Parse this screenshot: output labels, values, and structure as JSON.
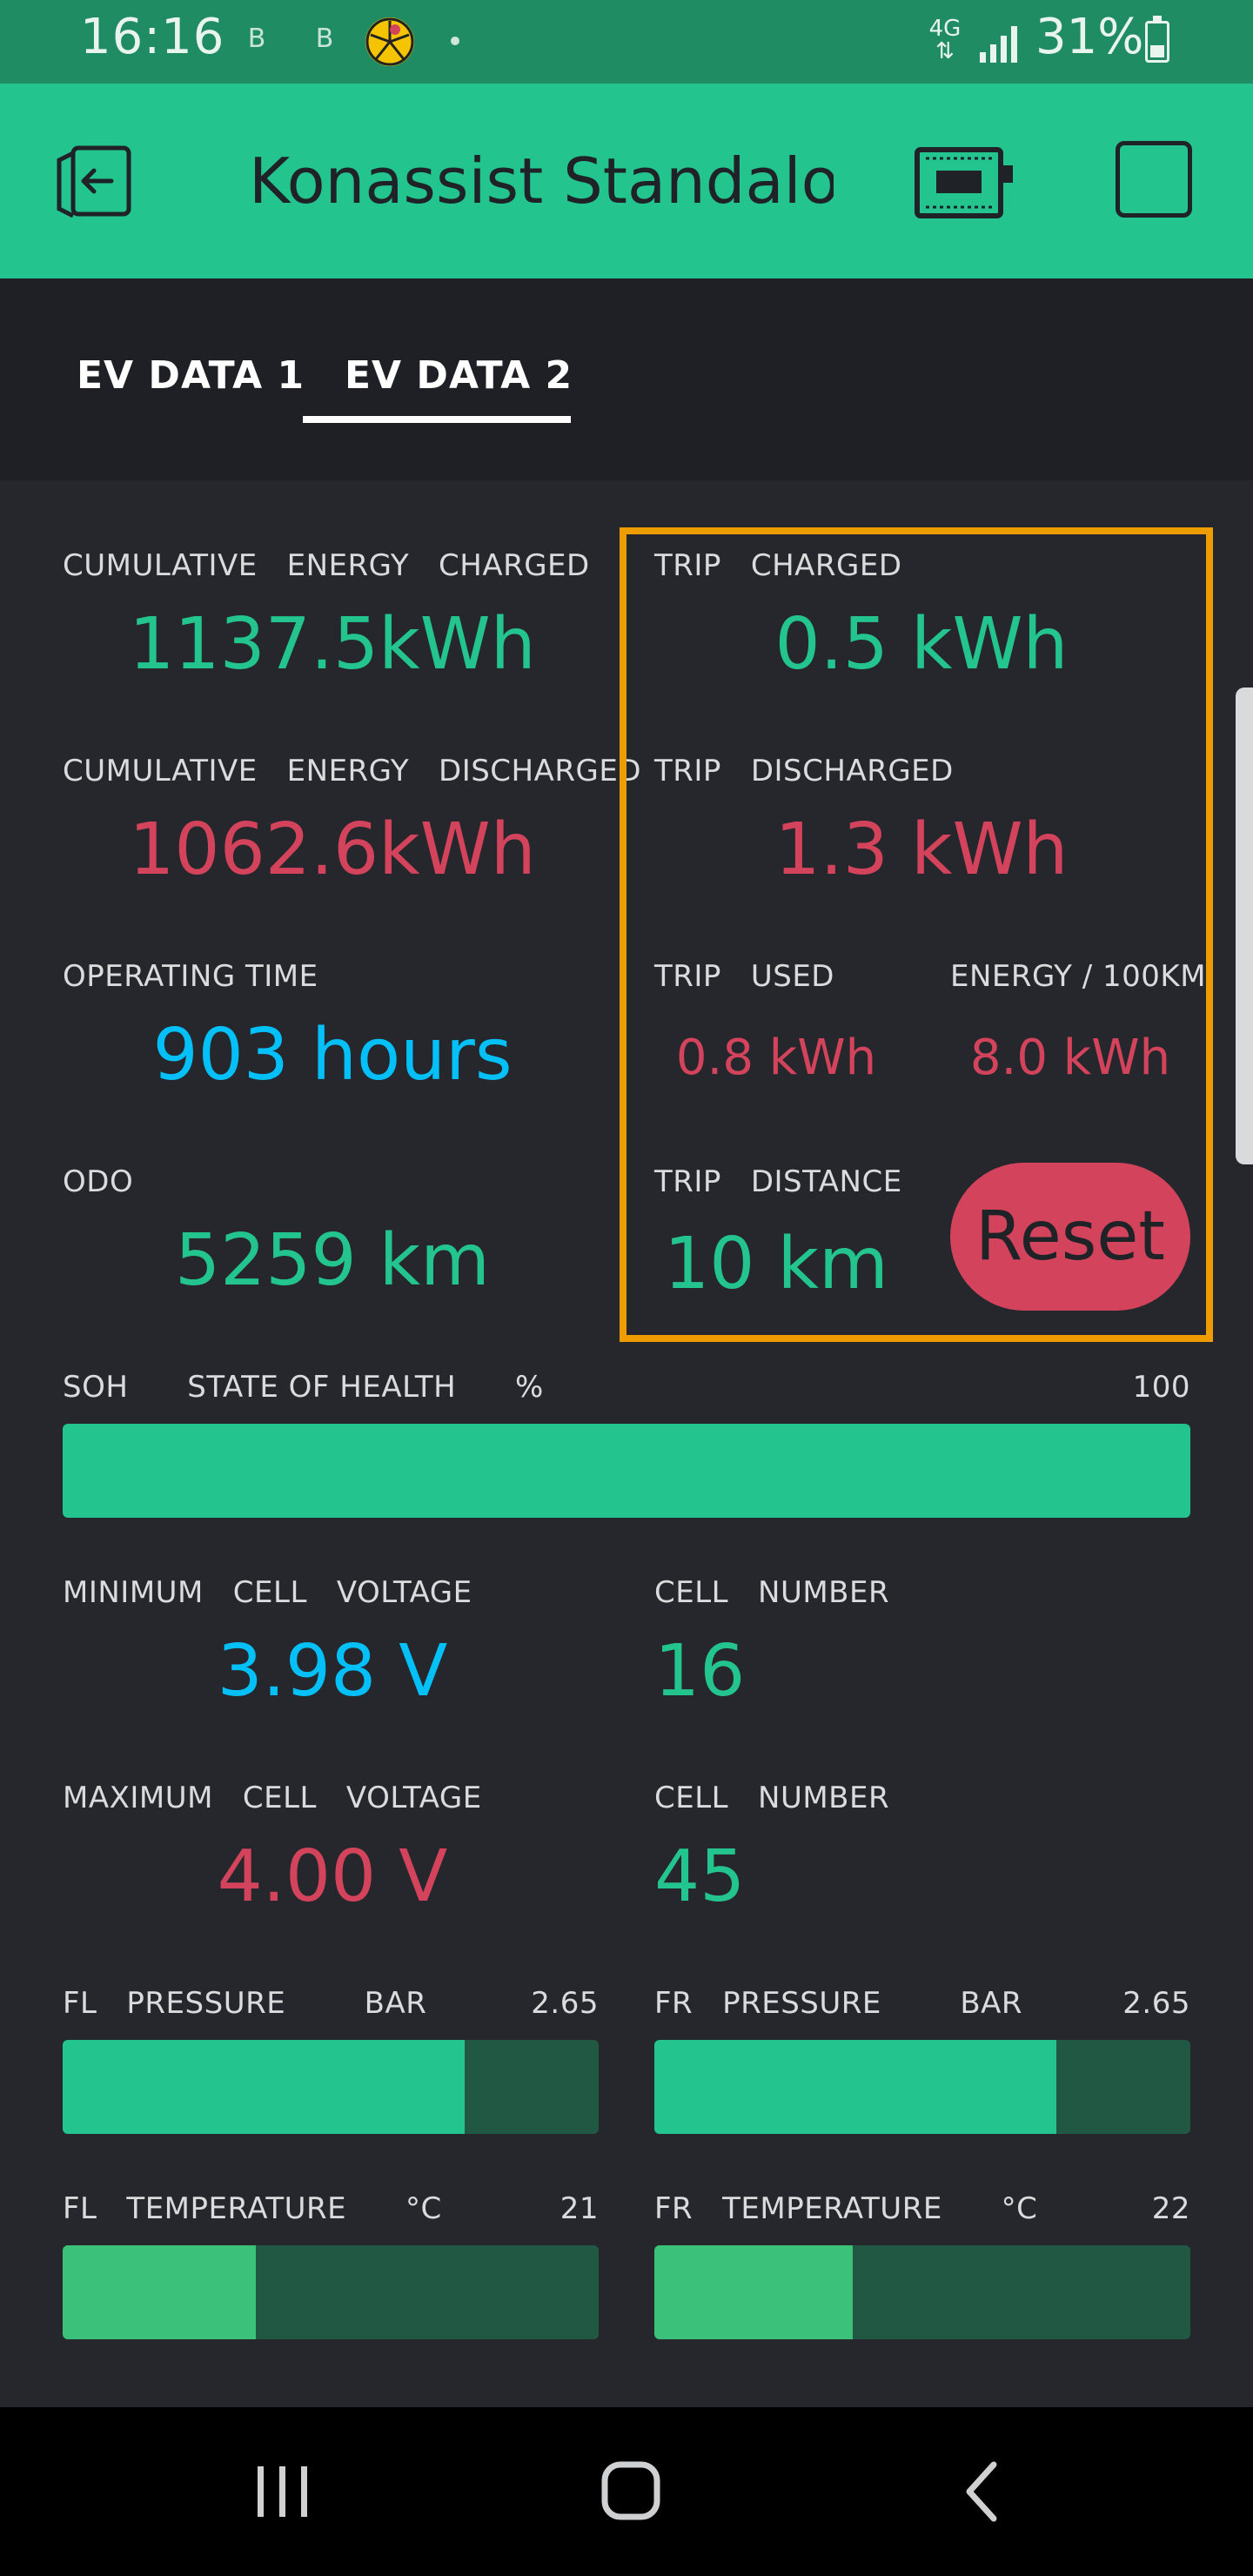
{
  "status_bar": {
    "time": "16:16",
    "notif_icon_1": "B",
    "notif_icon_2": "B",
    "network": "4G",
    "battery_percent": "31%",
    "battery_level": 0.31
  },
  "app_bar": {
    "title": "Konassist Standalone",
    "icons": [
      "back-icon",
      "device-icon",
      "square-icon"
    ]
  },
  "tabs": [
    {
      "label": "EV DATA 1",
      "selected": false
    },
    {
      "label": "EV DATA 2",
      "selected": true
    }
  ],
  "colors": {
    "accent_green": "#23c48e",
    "red": "#d3435c",
    "blue": "#04c0f8",
    "frame_orange": "#ed9d00"
  },
  "widgets": {
    "cum_charged": {
      "label": "CUMULATIVE   ENERGY   CHARGED",
      "value": "1137.5kWh"
    },
    "cum_discharged": {
      "label": "CUMULATIVE   ENERGY   DISCHARGED",
      "value": "1062.6kWh"
    },
    "operating_time": {
      "label": "OPERATING TIME",
      "value": "903 hours"
    },
    "odo": {
      "label": "ODO",
      "value": "5259 km"
    },
    "trip_charged": {
      "label": "TRIP   CHARGED",
      "value": "0.5 kWh"
    },
    "trip_discharged": {
      "label": "TRIP   DISCHARGED",
      "value": "1.3 kWh"
    },
    "trip_used": {
      "label": "TRIP   USED",
      "value": "0.8 kWh"
    },
    "energy_100km": {
      "label": "ENERGY / 100KM",
      "value": "8.0 kWh"
    },
    "trip_distance": {
      "label": "TRIP   DISTANCE",
      "value": "10 km"
    },
    "reset_button": "Reset",
    "soh": {
      "label": "SOH      STATE OF HEALTH      %",
      "value": "100",
      "level": 1.0
    },
    "min_cell_voltage": {
      "label": "MINIMUM   CELL   VOLTAGE",
      "value": "3.98 V"
    },
    "min_cell_number": {
      "label": "CELL   NUMBER",
      "value": "16"
    },
    "max_cell_voltage": {
      "label": "MAXIMUM   CELL   VOLTAGE",
      "value": "4.00 V"
    },
    "max_cell_number": {
      "label": "CELL   NUMBER",
      "value": "45"
    },
    "fl_pressure": {
      "label": "FL   PRESSURE        BAR",
      "value": "2.65",
      "level": 0.75
    },
    "fr_pressure": {
      "label": "FR   PRESSURE        BAR",
      "value": "2.65",
      "level": 0.75
    },
    "fl_temperature": {
      "label": "FL   TEMPERATURE      °C",
      "value": "21",
      "level": 0.36
    },
    "fr_temperature": {
      "label": "FR   TEMPERATURE      °C",
      "value": "22",
      "level": 0.37
    }
  },
  "nav_bar": {
    "icons": [
      "recent-apps-icon",
      "home-icon",
      "back-nav-icon"
    ]
  }
}
